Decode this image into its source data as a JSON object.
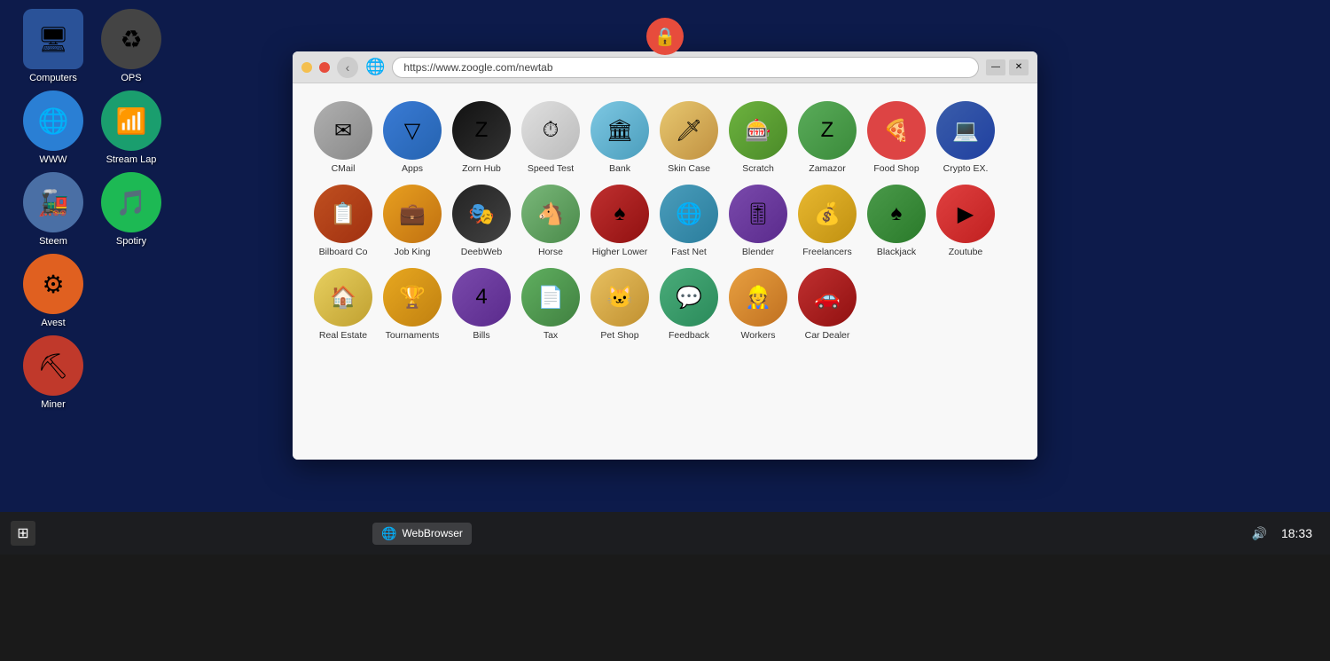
{
  "desktop": {
    "background_color": "#0d1b4b"
  },
  "lock_icon": "🔒",
  "desktop_icons": [
    {
      "id": "computers",
      "label": "Computers",
      "emoji": "🖥",
      "color_class": "icon-computers",
      "round": false
    },
    {
      "id": "ops",
      "label": "OPS",
      "emoji": "♻",
      "color_class": "icon-ops",
      "round": true
    },
    {
      "id": "www",
      "label": "WWW",
      "emoji": "🌐",
      "color_class": "icon-www",
      "round": true
    },
    {
      "id": "streamlap",
      "label": "Stream Lap",
      "emoji": "📶",
      "color_class": "icon-streamlap",
      "round": true
    },
    {
      "id": "steem",
      "label": "Steem",
      "emoji": "🚂",
      "color_class": "icon-steem",
      "round": true
    },
    {
      "id": "spotiry",
      "label": "Spotiry",
      "emoji": "🎵",
      "color_class": "icon-spotiry",
      "round": true
    },
    {
      "id": "avest",
      "label": "Avest",
      "emoji": "⚙",
      "color_class": "icon-avest",
      "round": true
    },
    {
      "id": "miner",
      "label": "Miner",
      "emoji": "⛏",
      "color_class": "icon-miner",
      "round": true
    }
  ],
  "browser": {
    "url": "https://www.zoogle.com/newtab",
    "title": "Web Browser"
  },
  "apps": [
    {
      "id": "cmail",
      "label": "CMail",
      "emoji": "✉",
      "color_class": "app-cmail"
    },
    {
      "id": "apps",
      "label": "Apps",
      "emoji": "▽",
      "color_class": "app-apps"
    },
    {
      "id": "zornhub",
      "label": "Zorn Hub",
      "emoji": "Z",
      "color_class": "app-zornhub"
    },
    {
      "id": "speedtest",
      "label": "Speed Test",
      "emoji": "⏱",
      "color_class": "app-speedtest"
    },
    {
      "id": "bank",
      "label": "Bank",
      "emoji": "🏛",
      "color_class": "app-bank"
    },
    {
      "id": "skincase",
      "label": "Skin Case",
      "emoji": "🗡",
      "color_class": "app-skincase"
    },
    {
      "id": "scratch",
      "label": "Scratch",
      "emoji": "🎰",
      "color_class": "app-scratch"
    },
    {
      "id": "zamazor",
      "label": "Zamazor",
      "emoji": "Z",
      "color_class": "app-zamazor"
    },
    {
      "id": "foodshop",
      "label": "Food Shop",
      "emoji": "🍕",
      "color_class": "app-foodshop"
    },
    {
      "id": "cryptoex",
      "label": "Crypto EX.",
      "emoji": "💻",
      "color_class": "app-cryptoex"
    },
    {
      "id": "billboard",
      "label": "Bilboard Co",
      "emoji": "📋",
      "color_class": "app-billboard"
    },
    {
      "id": "jobking",
      "label": "Job King",
      "emoji": "💼",
      "color_class": "app-jobking"
    },
    {
      "id": "deebweb",
      "label": "DeebWeb",
      "emoji": "🎭",
      "color_class": "app-deebweb"
    },
    {
      "id": "horse",
      "label": "Horse",
      "emoji": "🐴",
      "color_class": "app-horse"
    },
    {
      "id": "higherlower",
      "label": "Higher Lower",
      "emoji": "♠",
      "color_class": "app-higherlower"
    },
    {
      "id": "fastnet",
      "label": "Fast Net",
      "emoji": "🌐",
      "color_class": "app-fastnet"
    },
    {
      "id": "blender",
      "label": "Blender",
      "emoji": "🎚",
      "color_class": "app-blender"
    },
    {
      "id": "freelancers",
      "label": "Freelancers",
      "emoji": "💰",
      "color_class": "app-freelancers"
    },
    {
      "id": "blackjack",
      "label": "Blackjack",
      "emoji": "♠",
      "color_class": "app-blackjack"
    },
    {
      "id": "zoutube",
      "label": "Zoutube",
      "emoji": "▶",
      "color_class": "app-zoutube"
    },
    {
      "id": "realestate",
      "label": "Real Estate",
      "emoji": "🏠",
      "color_class": "app-realestate"
    },
    {
      "id": "tournaments",
      "label": "Tournaments",
      "emoji": "🏆",
      "color_class": "app-tournaments"
    },
    {
      "id": "bills",
      "label": "Bills",
      "emoji": "4",
      "color_class": "app-bills"
    },
    {
      "id": "tax",
      "label": "Tax",
      "emoji": "📄",
      "color_class": "app-tax"
    },
    {
      "id": "petshop",
      "label": "Pet Shop",
      "emoji": "🐱",
      "color_class": "app-petshop"
    },
    {
      "id": "feedback",
      "label": "Feedback",
      "emoji": "💬",
      "color_class": "app-feedback"
    },
    {
      "id": "workers",
      "label": "Workers",
      "emoji": "👷",
      "color_class": "app-workers"
    },
    {
      "id": "cardealer",
      "label": "Car Dealer",
      "emoji": "🚗",
      "color_class": "app-cardealer"
    }
  ],
  "taskbar": {
    "browser_label": "WebBrowser",
    "volume_icon": "🔊",
    "time": "18:33"
  }
}
